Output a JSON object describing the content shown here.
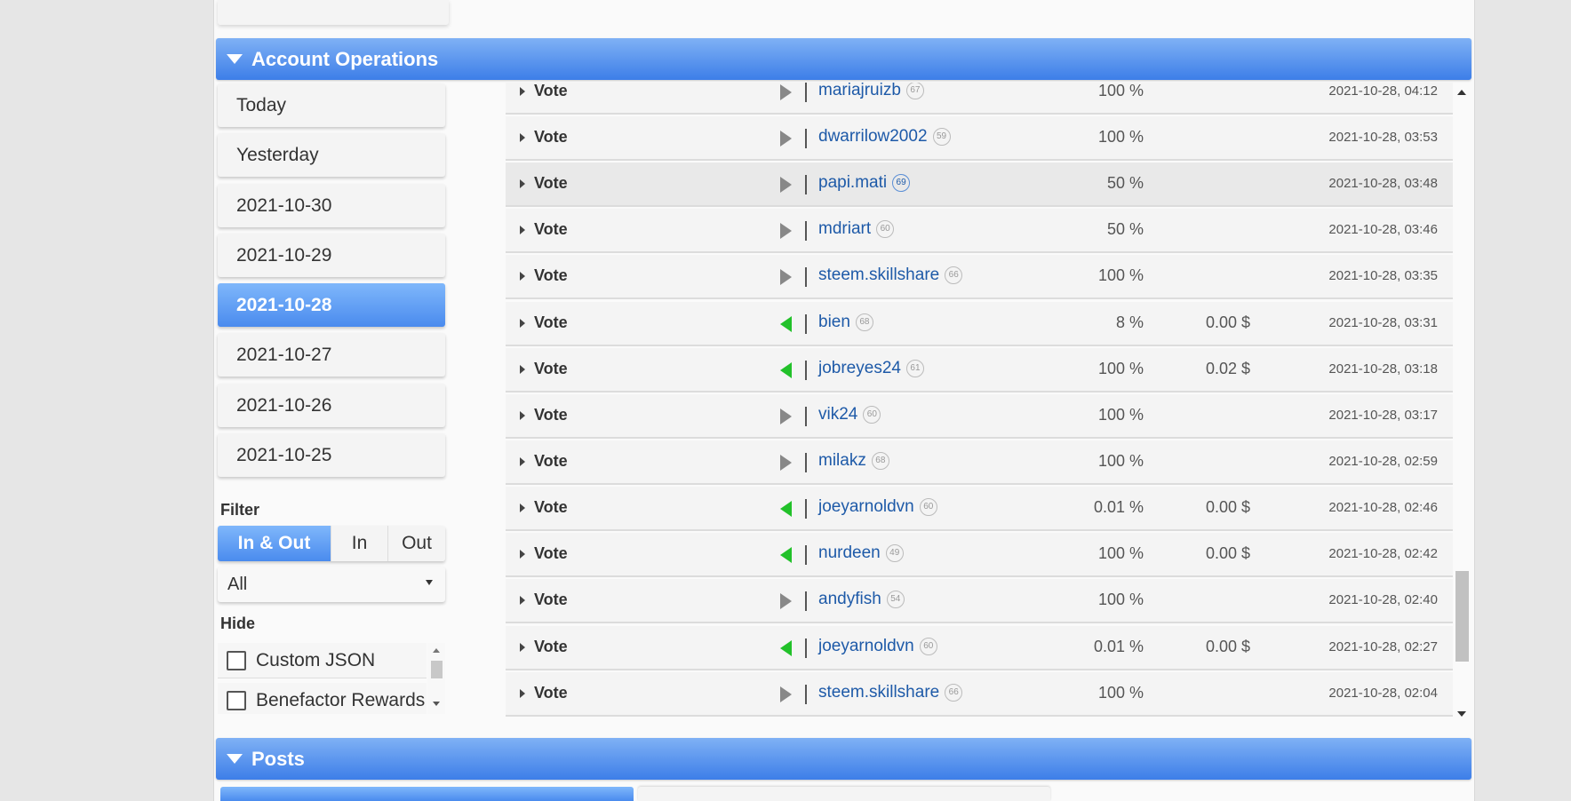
{
  "sections": {
    "account_operations": "Account Operations",
    "posts": "Posts"
  },
  "dates": [
    "Today",
    "Yesterday",
    "2021-10-30",
    "2021-10-29",
    "2021-10-28",
    "2021-10-27",
    "2021-10-26",
    "2021-10-25"
  ],
  "selected_date": "2021-10-28",
  "filter": {
    "label": "Filter",
    "options": [
      "In & Out",
      "In",
      "Out"
    ],
    "selected": "In & Out",
    "type_select": "All"
  },
  "hide": {
    "label": "Hide",
    "items": [
      "Custom JSON",
      "Benefactor Rewards"
    ]
  },
  "operations": [
    {
      "type": "Vote",
      "direction": "out",
      "user": "mariajruizb",
      "rep": "67",
      "pct": "100 %",
      "value": "",
      "time": "2021-10-28, 04:12"
    },
    {
      "type": "Vote",
      "direction": "out",
      "user": "dwarrilow2002",
      "rep": "59",
      "pct": "100 %",
      "value": "",
      "time": "2021-10-28, 03:53"
    },
    {
      "type": "Vote",
      "direction": "out",
      "user": "papi.mati",
      "rep": "69",
      "pct": "50 %",
      "value": "",
      "time": "2021-10-28, 03:48"
    },
    {
      "type": "Vote",
      "direction": "out",
      "user": "mdriart",
      "rep": "60",
      "pct": "50 %",
      "value": "",
      "time": "2021-10-28, 03:46"
    },
    {
      "type": "Vote",
      "direction": "out",
      "user": "steem.skillshare",
      "rep": "66",
      "pct": "100 %",
      "value": "",
      "time": "2021-10-28, 03:35"
    },
    {
      "type": "Vote",
      "direction": "in",
      "user": "bien",
      "rep": "68",
      "pct": "8 %",
      "value": "0.00 $",
      "time": "2021-10-28, 03:31"
    },
    {
      "type": "Vote",
      "direction": "in",
      "user": "jobreyes24",
      "rep": "61",
      "pct": "100 %",
      "value": "0.02 $",
      "time": "2021-10-28, 03:18"
    },
    {
      "type": "Vote",
      "direction": "out",
      "user": "vik24",
      "rep": "60",
      "pct": "100 %",
      "value": "",
      "time": "2021-10-28, 03:17"
    },
    {
      "type": "Vote",
      "direction": "out",
      "user": "milakz",
      "rep": "68",
      "pct": "100 %",
      "value": "",
      "time": "2021-10-28, 02:59"
    },
    {
      "type": "Vote",
      "direction": "in",
      "user": "joeyarnoldvn",
      "rep": "60",
      "pct": "0.01 %",
      "value": "0.00 $",
      "time": "2021-10-28, 02:46"
    },
    {
      "type": "Vote",
      "direction": "in",
      "user": "nurdeen",
      "rep": "49",
      "pct": "100 %",
      "value": "0.00 $",
      "time": "2021-10-28, 02:42"
    },
    {
      "type": "Vote",
      "direction": "out",
      "user": "andyfish",
      "rep": "54",
      "pct": "100 %",
      "value": "",
      "time": "2021-10-28, 02:40"
    },
    {
      "type": "Vote",
      "direction": "in",
      "user": "joeyarnoldvn",
      "rep": "60",
      "pct": "0.01 %",
      "value": "0.00 $",
      "time": "2021-10-28, 02:27"
    },
    {
      "type": "Vote",
      "direction": "out",
      "user": "steem.skillshare",
      "rep": "66",
      "pct": "100 %",
      "value": "",
      "time": "2021-10-28, 02:04"
    }
  ],
  "colors": {
    "header_blue": "#3d7ee8",
    "link_blue": "#1e5aa8",
    "incoming_green": "#22c12a",
    "outgoing_gray": "#888888"
  }
}
